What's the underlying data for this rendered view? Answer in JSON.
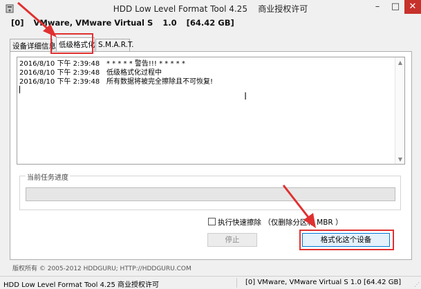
{
  "window": {
    "title": "HDD Low Level Format Tool 4.25",
    "license": "商业授权许可"
  },
  "device": {
    "index": "[0]",
    "name": "VMware, VMware Virtual S",
    "version": "1.0",
    "size": "[64.42 GB]"
  },
  "tabs": [
    {
      "label": "设备详细信息"
    },
    {
      "label": "低级格式化"
    },
    {
      "label": "S.M.A.R.T."
    }
  ],
  "log": [
    {
      "time": "2016/8/10 下午 2:39:48",
      "message": "* * * * *  警告!!! * * * * *"
    },
    {
      "time": "2016/8/10 下午 2:39:48",
      "message": "低级格式化过程中"
    },
    {
      "time": "2016/8/10 下午 2:39:48",
      "message": "所有数据将被完全擦除且不可恢复!"
    }
  ],
  "progress": {
    "label": "当前任务进度",
    "percent": 0
  },
  "options": {
    "quick_wipe_label": "执行快速擦除 （仅删除分区和 MBR ）",
    "quick_wipe_checked": false
  },
  "buttons": {
    "stop": "停止",
    "format": "格式化这个设备"
  },
  "copyright": "版权所有 © 2005-2012 HDDGURU; HTTP://HDDGURU.COM",
  "status": {
    "left": "HDD Low Level Format Tool 4.25   商业授权许可",
    "right": "[0]  VMware, VMware Virtual S   1.0   [64.42 GB]"
  },
  "colors": {
    "highlight": "#e03030",
    "close_button": "#c7312b"
  }
}
